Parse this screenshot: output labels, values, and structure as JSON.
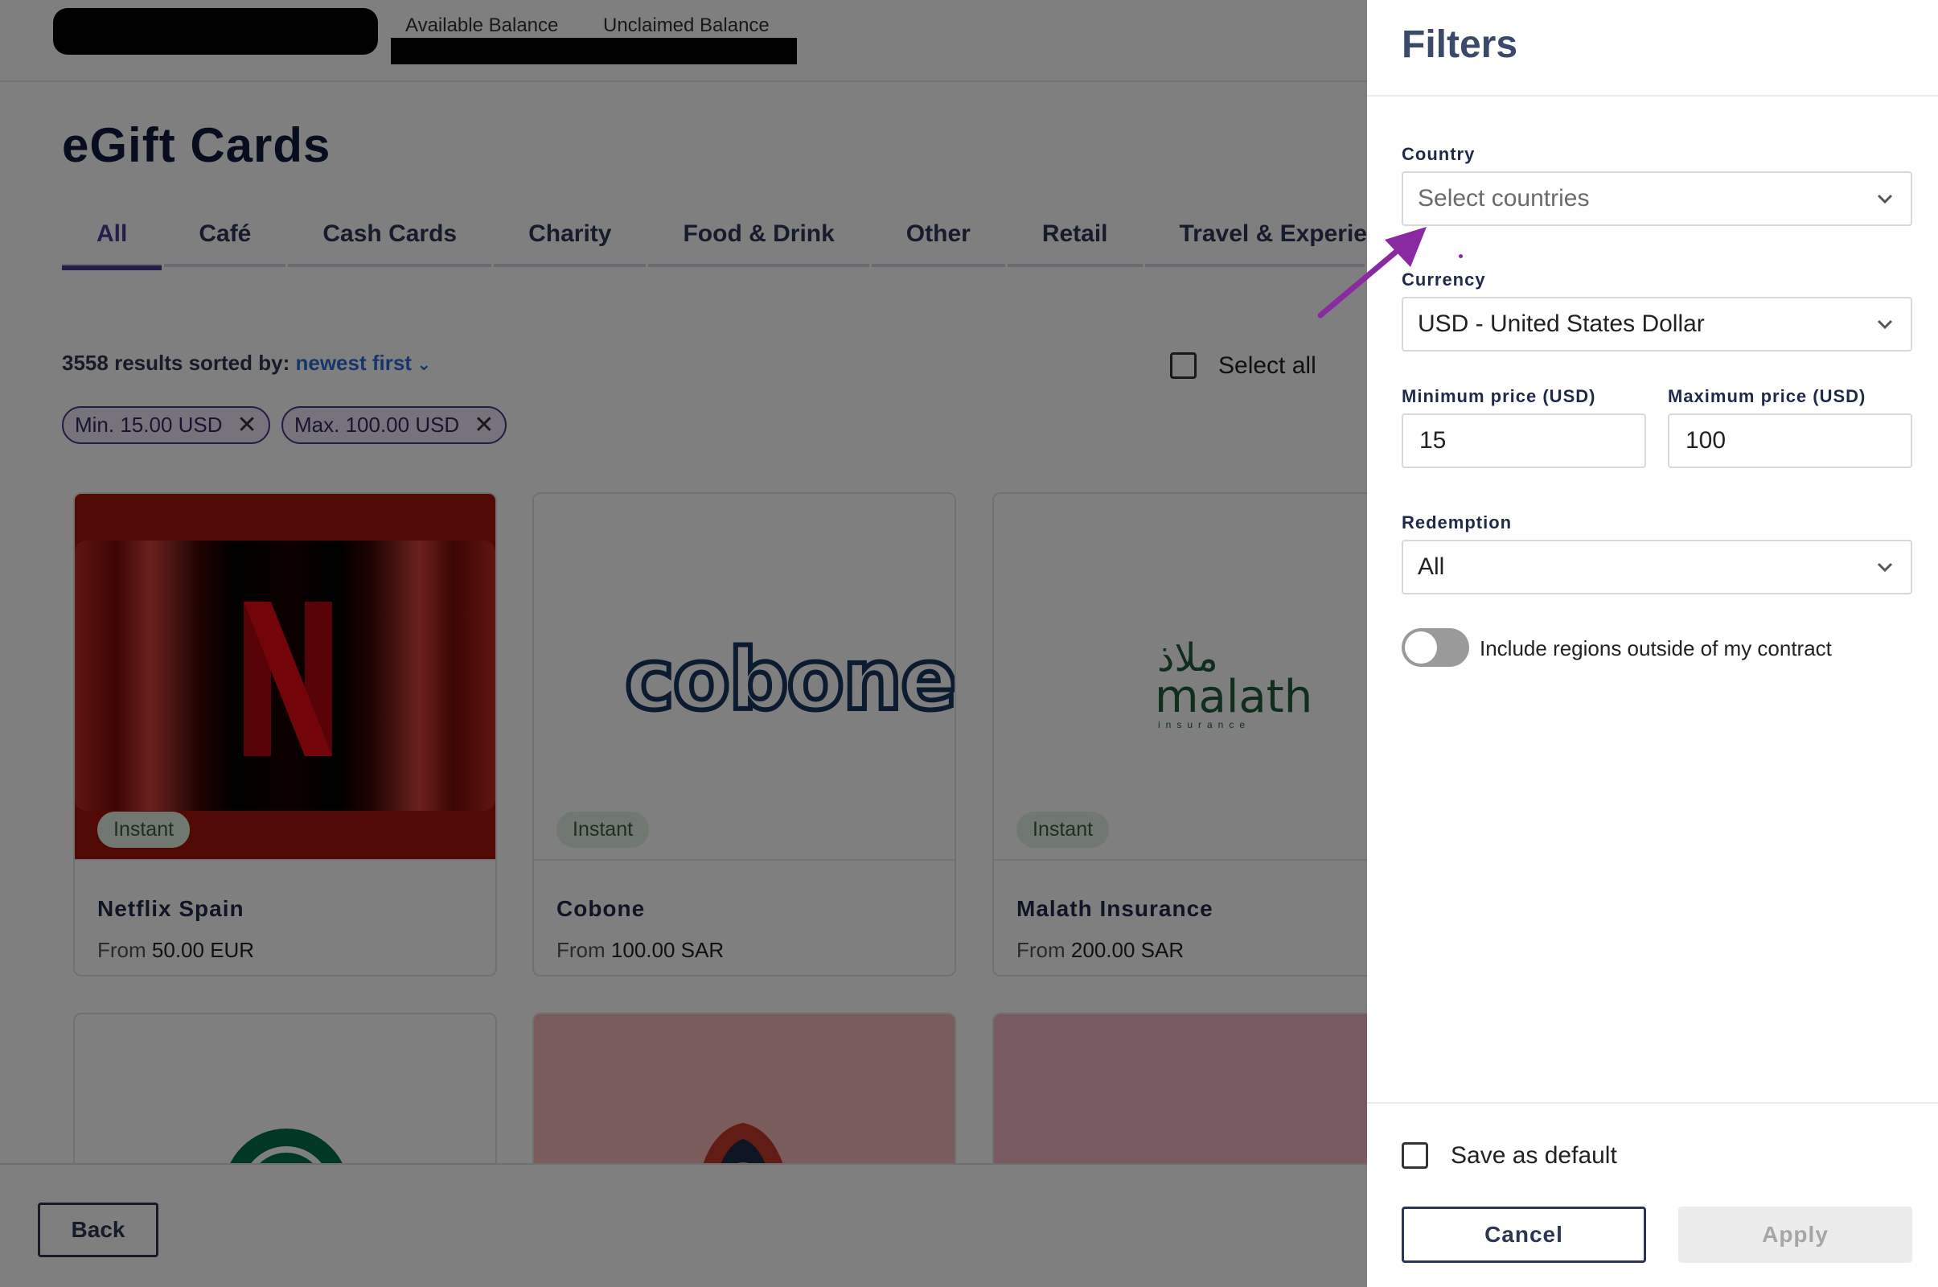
{
  "header": {
    "available_balance_label": "Available Balance",
    "unclaimed_balance_label": "Unclaimed Balance"
  },
  "page": {
    "title": "eGift Cards",
    "tabs": [
      {
        "label": "All",
        "active": true
      },
      {
        "label": "Café"
      },
      {
        "label": "Cash Cards"
      },
      {
        "label": "Charity"
      },
      {
        "label": "Food & Drink"
      },
      {
        "label": "Other"
      },
      {
        "label": "Retail"
      },
      {
        "label": "Travel & Experie"
      }
    ],
    "results_count": "3558",
    "results_text": "results sorted by:",
    "sort_value": "newest first",
    "select_all_label": "Select all",
    "chips": [
      "Min. 15.00 USD",
      "Max. 100.00 USD"
    ],
    "cards": [
      {
        "name": "Netflix Spain",
        "badge": "Instant",
        "price_prefix": "From",
        "price": "50.00 EUR"
      },
      {
        "name": "Cobone",
        "badge": "Instant",
        "price_prefix": "From",
        "price": "100.00 SAR",
        "logo_text": "cobone"
      },
      {
        "name": "Malath Insurance",
        "badge": "Instant",
        "price_prefix": "From",
        "price": "200.00 SAR",
        "logo_text": "malath",
        "logo_arabic": "ملاذ",
        "logo_sub": "insurance"
      }
    ],
    "back_label": "Back"
  },
  "filters": {
    "title": "Filters",
    "country_label": "Country",
    "country_placeholder": "Select countries",
    "currency_label": "Currency",
    "currency_value": "USD - United States Dollar",
    "min_price_label": "Minimum price (USD)",
    "min_price_value": "15",
    "max_price_label": "Maximum price (USD)",
    "max_price_value": "100",
    "redemption_label": "Redemption",
    "redemption_value": "All",
    "include_regions_label": "Include regions outside of my contract",
    "include_regions_on": false,
    "save_default_label": "Save as default",
    "cancel_label": "Cancel",
    "apply_label": "Apply"
  },
  "colors": {
    "accent": "#4d3c8f",
    "link": "#2f6bd6",
    "annotation_arrow": "#8a2aa3"
  }
}
